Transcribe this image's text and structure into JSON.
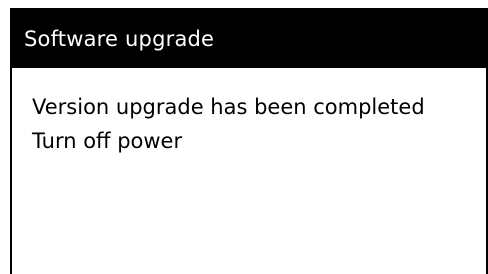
{
  "dialog": {
    "title": "Software upgrade",
    "messages": [
      "Version upgrade has been completed",
      "Turn off power"
    ]
  }
}
